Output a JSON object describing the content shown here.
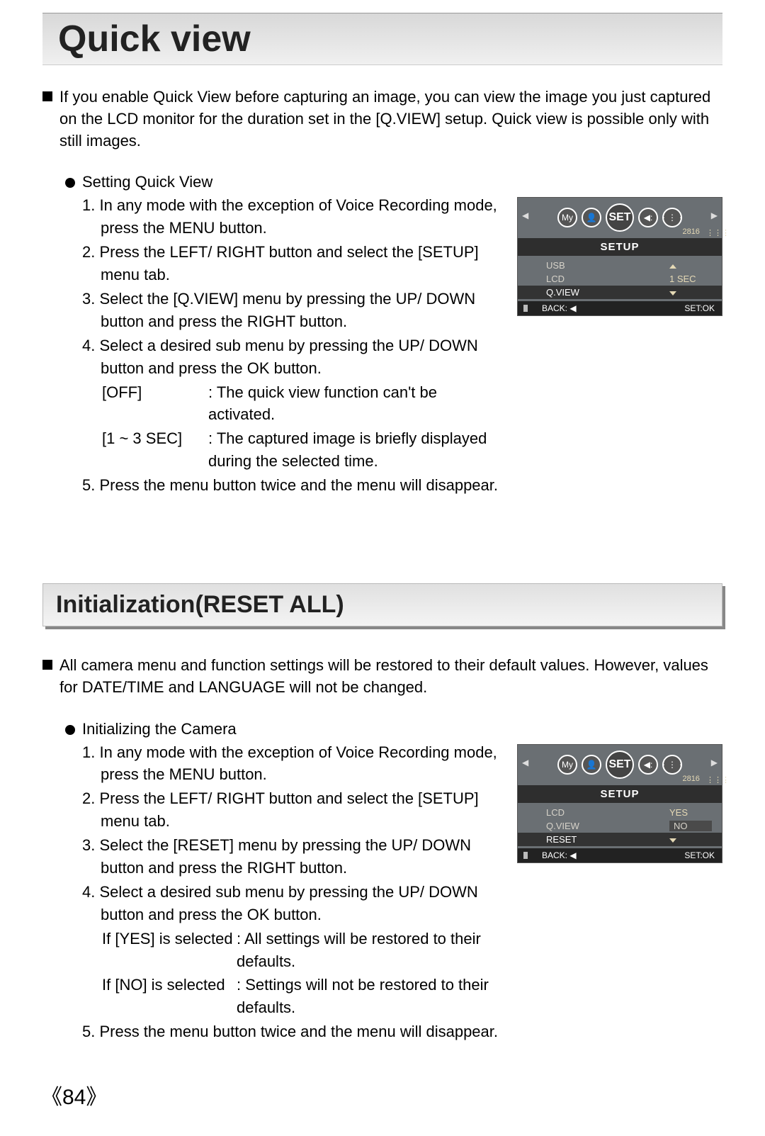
{
  "page_number": "84",
  "section1": {
    "title": "Quick view",
    "intro": "If you enable Quick View before capturing an image, you can view the image you just captured on the LCD monitor for the duration set in the [Q.VIEW] setup. Quick view is possible only with still images.",
    "sub_heading": "Setting Quick View",
    "steps": {
      "s1": "1. In any mode with the exception of Voice Recording mode, press the MENU button.",
      "s2": "2. Press the LEFT/ RIGHT button and select the [SETUP] menu tab.",
      "s3": "3. Select the [Q.VIEW] menu by pressing the UP/ DOWN button and press the RIGHT button.",
      "s4": "4. Select a desired sub menu by pressing the UP/ DOWN button and press the OK button.",
      "opt1_key": "[OFF]",
      "opt1_val": ": The quick view function can't be activated.",
      "opt2_key": "[1 ~ 3 SEC]",
      "opt2_val": ": The captured image is briefly displayed during the selected time.",
      "s5": "5. Press the menu button twice and the menu will disappear."
    },
    "lcd": {
      "set_label": "SET",
      "res": "2816",
      "setup": "SETUP",
      "row1_label": "USB",
      "row2_label": "LCD",
      "row2_value": "1  SEC",
      "row3_label": "Q.VIEW",
      "back": "BACK:",
      "setok": "SET:OK"
    }
  },
  "section2": {
    "title": "Initialization(RESET ALL)",
    "intro": "All camera menu and function settings will be restored to their default values. However, values for DATE/TIME and LANGUAGE will not be changed.",
    "sub_heading": "Initializing the Camera",
    "steps": {
      "s1": "1. In any mode with the exception of Voice Recording mode, press the MENU button.",
      "s2": "2. Press the LEFT/ RIGHT button and select the [SETUP] menu tab.",
      "s3": "3. Select the [RESET] menu by pressing the UP/ DOWN button and press the RIGHT button.",
      "s4": "4. Select a desired sub menu by pressing the UP/ DOWN button and press the OK button.",
      "opt1_key": "If [YES] is selected",
      "opt1_val": ": All settings will be restored to their defaults.",
      "opt2_key": "If [NO] is selected",
      "opt2_val": ": Settings will not be restored to their defaults.",
      "s5": "5. Press the menu button twice and the menu will disappear."
    },
    "lcd": {
      "set_label": "SET",
      "res": "2816",
      "setup": "SETUP",
      "row1_label": "LCD",
      "row1_value": "YES",
      "row2_label": "Q.VIEW",
      "row2_value": "NO",
      "row3_label": "RESET",
      "back": "BACK:",
      "setok": "SET:OK"
    }
  }
}
